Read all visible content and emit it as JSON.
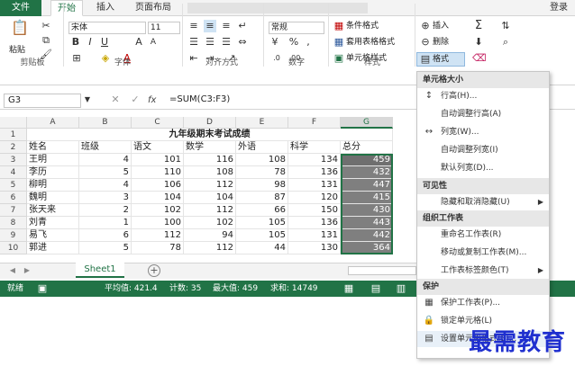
{
  "tabs": [
    "文件",
    "开始",
    "插入",
    "页面布局"
  ],
  "login": "登录",
  "ribbon": {
    "paste_label": "粘贴",
    "font_name": "宋体",
    "font_size": "11",
    "font_buttons": [
      "B",
      "I",
      "U",
      "A",
      "A"
    ],
    "number_format": "常规",
    "number_buttons": [
      "%",
      ","
    ],
    "styles": [
      "条件格式",
      "套用表格格式",
      "单元格样式"
    ],
    "cells": [
      "插入",
      "删除",
      "格式"
    ],
    "groups": [
      "剪贴板",
      "字体",
      "对齐方式",
      "数字",
      "样式"
    ]
  },
  "formula_bar": {
    "name_box": "G3",
    "fx": "fx",
    "formula": "=SUM(C3:F3)"
  },
  "grid": {
    "columns": [
      "A",
      "B",
      "C",
      "D",
      "E",
      "F",
      "G"
    ],
    "rows": [
      "1",
      "2",
      "3",
      "4",
      "5",
      "6",
      "7",
      "8",
      "9",
      "10"
    ],
    "title": "九年级期末考试成绩",
    "headers": [
      "姓名",
      "班级",
      "语文",
      "数学",
      "外语",
      "科学",
      "总分"
    ],
    "data": [
      [
        "王明",
        "4",
        "101",
        "116",
        "108",
        "134",
        "459"
      ],
      [
        "李历",
        "5",
        "110",
        "108",
        "78",
        "136",
        "432"
      ],
      [
        "柳明",
        "4",
        "106",
        "112",
        "98",
        "131",
        "447"
      ],
      [
        "魏明",
        "3",
        "104",
        "104",
        "87",
        "120",
        "415"
      ],
      [
        "张天来",
        "2",
        "102",
        "112",
        "66",
        "150",
        "430"
      ],
      [
        "刘青",
        "1",
        "100",
        "102",
        "105",
        "136",
        "443"
      ],
      [
        "易飞",
        "6",
        "112",
        "94",
        "105",
        "131",
        "442"
      ],
      [
        "郭进",
        "5",
        "78",
        "112",
        "44",
        "130",
        "364"
      ]
    ]
  },
  "sheet_tab": "Sheet1",
  "status": {
    "ready": "就绪",
    "average": "平均值: 421.4",
    "count": "计数: 35",
    "max": "最大值: 459",
    "sum": "求和: 14749"
  },
  "menu": {
    "sections": [
      "单元格大小",
      "可见性",
      "组织工作表",
      "保护"
    ],
    "size_items": [
      "行高(H)...",
      "自动调整行高(A)",
      "列宽(W)...",
      "自动调整列宽(I)",
      "默认列宽(D)..."
    ],
    "visibility_items": [
      "隐藏和取消隐藏(U)"
    ],
    "organize_items": [
      "重命名工作表(R)",
      "移动或复制工作表(M)...",
      "工作表标签颜色(T)"
    ],
    "protect_items": [
      "保护工作表(P)...",
      "锁定单元格(L)",
      "设置单元格格式(E)..."
    ]
  },
  "watermark": "最需教育",
  "accent": "#217346"
}
